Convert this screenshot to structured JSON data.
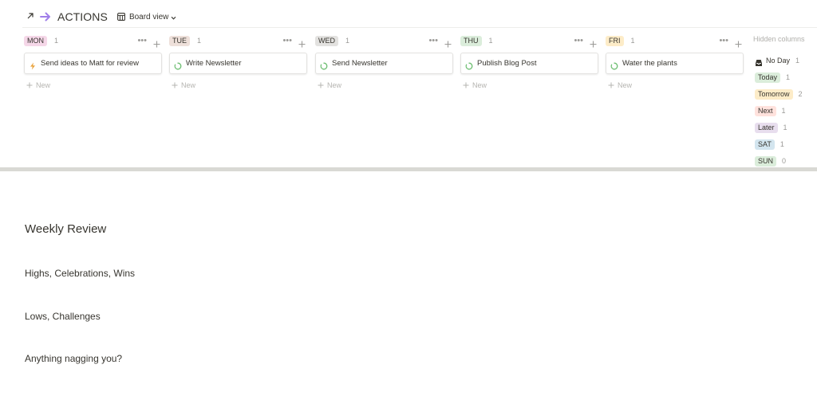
{
  "header": {
    "title": "ACTIONS",
    "view_label": "Board view"
  },
  "columns": [
    {
      "tag": "MON",
      "count": "1",
      "color": "#f5d7e8",
      "card": {
        "icon": "lightning-icon",
        "text": "Send ideas to Matt for review"
      },
      "new_label": "New"
    },
    {
      "tag": "TUE",
      "count": "1",
      "color": "#eee0da",
      "card": {
        "icon": "in-progress-icon",
        "text": "Write Newsletter"
      },
      "new_label": "New"
    },
    {
      "tag": "WED",
      "count": "1",
      "color": "#e3e2e0",
      "card": {
        "icon": "in-progress-icon",
        "text": "Send Newsletter"
      },
      "new_label": "New"
    },
    {
      "tag": "THU",
      "count": "1",
      "color": "#dbeddb",
      "card": {
        "icon": "in-progress-icon",
        "text": "Publish Blog Post"
      },
      "new_label": "New"
    },
    {
      "tag": "FRI",
      "count": "1",
      "color": "#fdecc8",
      "card": {
        "icon": "in-progress-icon",
        "text": "Water the plants"
      },
      "new_label": "New"
    }
  ],
  "hidden_columns": {
    "title": "Hidden columns",
    "items": [
      {
        "label": "No Day",
        "count": "1",
        "icon": "inbox-icon"
      },
      {
        "label": "Today",
        "count": "1",
        "color": "#dbeddb"
      },
      {
        "label": "Tomorrow",
        "count": "2",
        "color": "#fdecc8"
      },
      {
        "label": "Next",
        "count": "1",
        "color": "#ffe2dd"
      },
      {
        "label": "Later",
        "count": "1",
        "color": "#e8deee"
      },
      {
        "label": "SAT",
        "count": "1",
        "color": "#d3e5ef"
      },
      {
        "label": "SUN",
        "count": "0",
        "color": "#dbeddb"
      }
    ]
  },
  "document": {
    "heading": "Weekly Review",
    "sections": [
      "Highs, Celebrations, Wins",
      "Lows, Challenges",
      "Anything nagging you?"
    ]
  },
  "colors": {
    "accent_arrow": "#a07ee9",
    "progress_green": "#6fbf73",
    "lightning": "#e9a23b"
  }
}
